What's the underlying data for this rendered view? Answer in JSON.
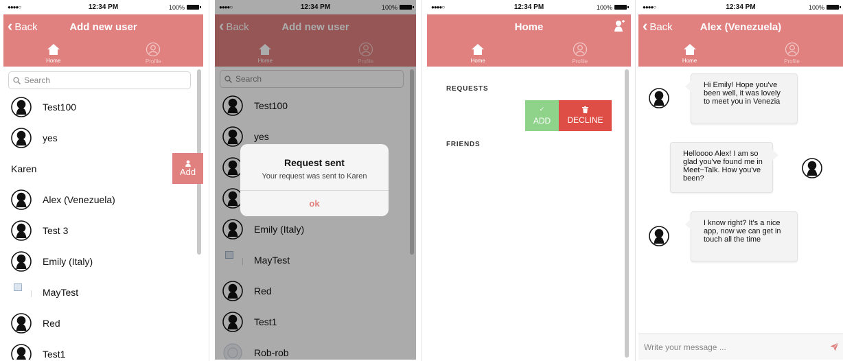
{
  "status": {
    "carrier": "●●●●○",
    "time": "12:34 PM",
    "battery": "100%"
  },
  "colors": {
    "accent": "#e0817f",
    "add_green": "#8fd38a",
    "decline_red": "#de4e46"
  },
  "tabs": {
    "home": "Home",
    "profile": "Profile"
  },
  "screen1": {
    "back_label": "Back",
    "title": "Add new user",
    "search_placeholder": "Search",
    "users": [
      "Test100",
      "yes",
      "Karen",
      "Alex (Venezuela)",
      "Test 3",
      "Emily (Italy)",
      "MayTest",
      "Red",
      "Test1"
    ],
    "add_label": "Add",
    "add_icon": "add-user-icon"
  },
  "screen2": {
    "back_label": "Back",
    "title": "Add new user",
    "search_placeholder": "Search",
    "users": [
      "Test100",
      "yes",
      "",
      "",
      "Emily (Italy)",
      "MayTest",
      "Red",
      "Test1",
      "Rob-rob"
    ],
    "alert": {
      "title": "Request sent",
      "message": "Your request was sent to Karen",
      "ok": "ok"
    }
  },
  "screen3": {
    "title": "Home",
    "requests_label": "REQUESTS",
    "friends_label": "FRIENDS",
    "add_label": "ADD",
    "decline_label": "DECLINE"
  },
  "screen4": {
    "back_label": "Back",
    "title": "Alex (Venezuela)",
    "messages": [
      "Hi Emily! Hope you've been well, it was lovely to meet you in Venezia",
      "Helloooo Alex! I am so glad you've found me in Meet~Talk. How you've been?",
      "I know right? It's a nice app, now we can get in touch all the time"
    ],
    "composer_placeholder": "Write your message ..."
  }
}
